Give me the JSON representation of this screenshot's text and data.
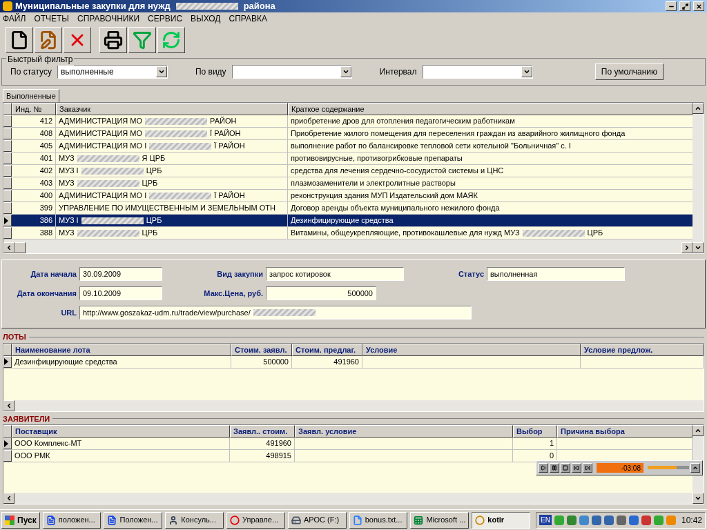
{
  "window": {
    "title": [
      "Муниципальные закупки для нужд",
      "района"
    ]
  },
  "menu": [
    "ФАЙЛ",
    "ОТЧЕТЫ",
    "СПРАВОЧНИКИ",
    "СЕРВИС",
    "ВЫХОД",
    "СПРАВКА"
  ],
  "toolbar": [
    {
      "kind": "new"
    },
    {
      "kind": "edit"
    },
    {
      "kind": "delete"
    },
    {
      "kind": "print"
    },
    {
      "kind": "filter"
    },
    {
      "kind": "refresh"
    }
  ],
  "quick_filter": {
    "title": "Быстрый фильтр",
    "fields": [
      {
        "label": "По статусу",
        "value": "выполненные"
      },
      {
        "label": "По виду"
      },
      {
        "label": "Интервал"
      }
    ],
    "default_button": "По умолчанию"
  },
  "tabs": [
    {
      "label": "Выполненные",
      "selected": true
    }
  ],
  "grid": {
    "columns": [
      "Инд. №",
      "Заказчик",
      "Краткое содержание"
    ],
    "rows": [
      {
        "id": "412",
        "customer": [
          "АДМИНИСТРАЦИЯ МО",
          "РАЙОН"
        ],
        "summary": [
          "приобретение дров для отопления педагогическим работникам"
        ],
        "selected": false
      },
      {
        "id": "408",
        "customer": [
          "АДМИНИСТРАЦИЯ МО",
          "Ї РАЙОН"
        ],
        "summary": [
          "Приобретение жилого помещения для переселения граждан из аварийного жилищного фонда"
        ],
        "selected": false
      },
      {
        "id": "405",
        "customer": [
          "АДМИНИСТРАЦИЯ МО І",
          "Ї РАЙОН"
        ],
        "summary": [
          "выполнение работ по балансировке тепловой сети котельной \"Больничная\" с. І"
        ],
        "selected": false
      },
      {
        "id": "401",
        "customer": [
          "МУЗ",
          "Я ЦРБ"
        ],
        "summary": [
          "противовирусные, противогрибковые препараты"
        ],
        "selected": false
      },
      {
        "id": "402",
        "customer": [
          "МУЗ І",
          "ЦРБ"
        ],
        "summary": [
          "средства для лечения сердечно-сосудистой системы и ЦНС"
        ],
        "selected": false
      },
      {
        "id": "403",
        "customer": [
          "МУЗ",
          "ЦРБ"
        ],
        "summary": [
          "плазмозаменители и электролитные растворы"
        ],
        "selected": false
      },
      {
        "id": "400",
        "customer": [
          "АДМИНИСТРАЦИЯ МО І",
          "Ї РАЙОН"
        ],
        "summary": [
          "реконструкция здания МУП Издательский дом МАЯК"
        ],
        "selected": false
      },
      {
        "id": "399",
        "customer": [
          "УПРАВЛЕНИЕ ПО ИМУЩЕСТВЕННЫМ И ЗЕМЕЛЬНЫМ ОТН"
        ],
        "summary": [
          "Договор аренды объекта муниципального нежилого фонда"
        ],
        "selected": false
      },
      {
        "id": "386",
        "customer": [
          "МУЗ І",
          "ЦРБ"
        ],
        "summary": [
          "Дезинфицирующие средства"
        ],
        "selected": true
      },
      {
        "id": "388",
        "customer": [
          "МУЗ",
          "ЦРБ"
        ],
        "summary": [
          "Витамины, общеукрепляющие, противокашлевые для нужд МУЗ",
          "ЦРБ"
        ],
        "selected": false
      }
    ]
  },
  "details": {
    "start_label": "Дата начала",
    "start": "30.09.2009",
    "end_label": "Дата окончания",
    "end": "09.10.2009",
    "type_label": "Вид закупки",
    "type": "запрос котировок",
    "price_label": "Макс.Цена, руб.",
    "price": "500000",
    "status_label": "Статус",
    "status": "выполненная",
    "url_label": "URL",
    "url": "http://www.goszakaz-udm.ru/trade/view/purchase/"
  },
  "lots": {
    "title": "ЛОТЫ",
    "columns": [
      "Наименование лота",
      "Стоим. заявл.",
      "Стоим. предлаг.",
      "Условие",
      "Условие предлож."
    ],
    "rows": [
      {
        "cells": [
          "Дезинфицирующие средства",
          "500000",
          "491960",
          "",
          ""
        ],
        "selected": true
      }
    ]
  },
  "applicants": {
    "title": "ЗАЯВИТЕЛИ",
    "columns": [
      "Поставщик",
      "Заявл.. стоим.",
      "Заявл. условие",
      "Выбор",
      "Причина выбора"
    ],
    "rows": [
      {
        "cells": [
          "ООО Комплекс-МТ",
          "491960",
          "",
          "1",
          ""
        ],
        "selected": true
      },
      {
        "cells": [
          "ООО РМК",
          "498915",
          "",
          "0",
          ""
        ],
        "selected": false
      }
    ]
  },
  "player": {
    "time": "-03:08",
    "level": 0.7
  },
  "taskbar": {
    "start": "Пуск",
    "items": [
      {
        "kind": "word",
        "label": "положен...",
        "selected": false
      },
      {
        "kind": "word",
        "label": "Положен...",
        "selected": false
      },
      {
        "kind": "person",
        "label": "Консуль...",
        "selected": false
      },
      {
        "kind": "opera",
        "label": "Управле...",
        "selected": false
      },
      {
        "kind": "drive",
        "label": "APOC (F:)",
        "selected": false
      },
      {
        "kind": "file",
        "label": "bonus.txt...",
        "selected": false
      },
      {
        "kind": "excel",
        "label": "Microsoft ...",
        "selected": false
      },
      {
        "kind": "app",
        "label": "kotir",
        "selected": true
      }
    ],
    "lang": "EN",
    "clock": "10:42"
  }
}
